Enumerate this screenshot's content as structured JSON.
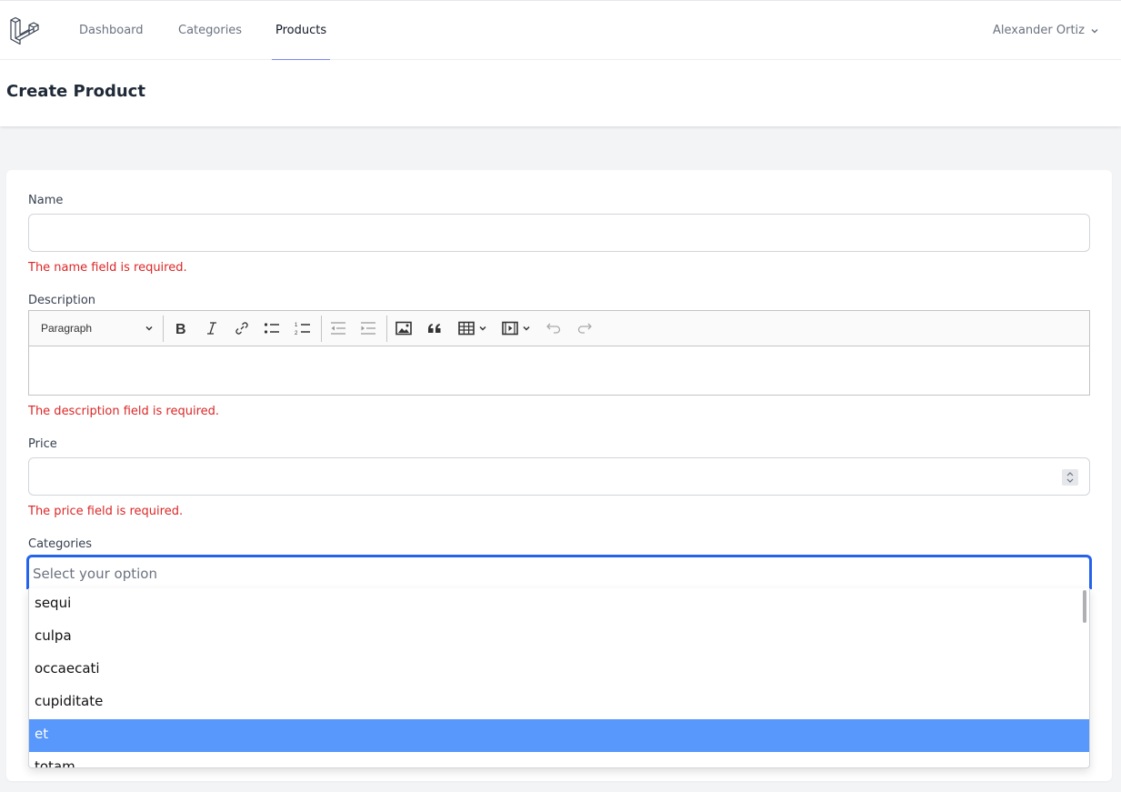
{
  "nav": {
    "logo": "laravel-logo",
    "links": [
      {
        "label": "Dashboard",
        "active": false
      },
      {
        "label": "Categories",
        "active": false
      },
      {
        "label": "Products",
        "active": true
      }
    ],
    "user": {
      "name": "Alexander Ortiz",
      "icon": "chevron-down-icon"
    }
  },
  "header": {
    "title": "Create Product"
  },
  "form": {
    "name": {
      "label": "Name",
      "value": "",
      "error": "The name field is required."
    },
    "description": {
      "label": "Description",
      "value": "",
      "error": "The description field is required.",
      "toolbar": {
        "heading_select": "Paragraph",
        "buttons": [
          "bold",
          "italic",
          "link",
          "bulleted-list",
          "numbered-list",
          "outdent",
          "indent",
          "image",
          "blockquote",
          "table",
          "media",
          "undo",
          "redo"
        ]
      }
    },
    "price": {
      "label": "Price",
      "value": "",
      "error": "The price field is required."
    },
    "categories": {
      "label": "Categories",
      "placeholder": "Select your option",
      "value": "",
      "options": [
        "sequi",
        "culpa",
        "occaecati",
        "cupiditate",
        "et",
        "totam"
      ],
      "highlighted": "et"
    }
  },
  "colors": {
    "active_tab_underline": "#818cf8",
    "error": "#dc2626",
    "focus_border": "#2563eb",
    "highlight_option": "#5897fb"
  }
}
